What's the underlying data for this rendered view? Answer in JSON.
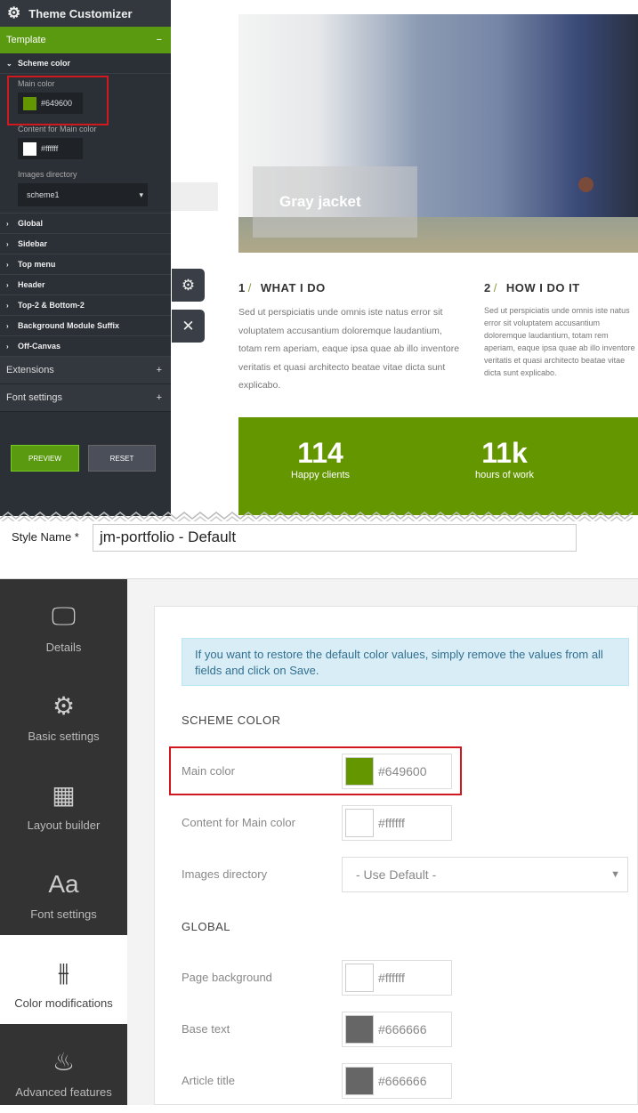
{
  "customizer": {
    "title": "Theme Customizer",
    "template_label": "Template",
    "template_toggle": "−",
    "scheme_label": "Scheme color",
    "main_color_label": "Main color",
    "main_color_value": "#649600",
    "content_main_label": "Content for Main color",
    "content_main_value": "#ffffff",
    "images_dir_label": "Images directory",
    "images_dir_value": "scheme1",
    "sections": [
      "Global",
      "Sidebar",
      "Top menu",
      "Header",
      "Top-2 & Bottom-2",
      "Background Module Suffix",
      "Off-Canvas"
    ],
    "groups": [
      {
        "label": "Extensions",
        "toggle": "+"
      },
      {
        "label": "Font settings",
        "toggle": "+"
      }
    ],
    "preview_label": "PREVIEW",
    "reset_label": "RESET"
  },
  "preview": {
    "image_caption": "Gray jacket",
    "columns": [
      {
        "num": "1",
        "slash": "/",
        "title": "WHAT I DO",
        "text": "Sed ut perspiciatis unde omnis iste natus error sit voluptatem accusantium doloremque laudantium, totam rem aperiam, eaque ipsa quae ab illo inventore veritatis et quasi architecto beatae vitae dicta sunt explicabo."
      },
      {
        "num": "2",
        "slash": "/",
        "title": "HOW I DO IT",
        "text": "Sed ut perspiciatis unde omnis iste natus error sit voluptatem accusantium doloremque laudantium, totam rem aperiam, eaque ipsa quae ab illo inventore veritatis et quasi architecto beatae vitae dicta sunt explicabo."
      }
    ],
    "stats": [
      {
        "value": "114",
        "label": "Happy clients"
      },
      {
        "value": "11k",
        "label": "hours of work"
      }
    ]
  },
  "admin": {
    "style_name_label": "Style Name *",
    "style_name_value": "jm-portfolio - Default",
    "sidebar": [
      {
        "label": "Details",
        "icon": "monitor-icon"
      },
      {
        "label": "Basic settings",
        "icon": "gear-icon"
      },
      {
        "label": "Layout builder",
        "icon": "grid-icon"
      },
      {
        "label": "Font settings",
        "icon": "font-icon"
      },
      {
        "label": "Color modifications",
        "icon": "sliders-icon"
      },
      {
        "label": "Advanced features",
        "icon": "flame-icon"
      }
    ],
    "info": "If you want to restore the default color values, simply remove the values from all fields and click on Save.",
    "scheme_heading": "SCHEME COLOR",
    "global_heading": "GLOBAL",
    "fields": [
      {
        "label": "Main color",
        "value": "#649600",
        "swatch": "#649600"
      },
      {
        "label": "Content for Main color",
        "value": "#ffffff",
        "swatch": "#ffffff"
      },
      {
        "label": "Images directory",
        "value": "- Use Default -"
      },
      {
        "label": "Page background",
        "value": "#ffffff",
        "swatch": "#ffffff"
      },
      {
        "label": "Base text",
        "value": "#666666",
        "swatch": "#666666"
      },
      {
        "label": "Article title",
        "value": "#666666",
        "swatch": "#666666"
      }
    ]
  },
  "colors": {
    "accent": "#649600",
    "highlight": "#d0181e"
  }
}
